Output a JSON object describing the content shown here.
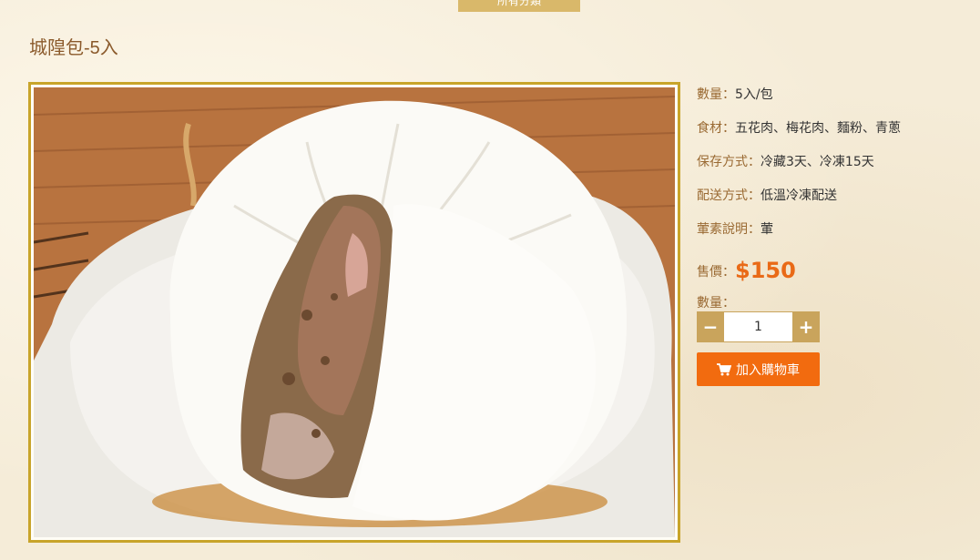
{
  "top_tab": {
    "label": "所有分類"
  },
  "product": {
    "title": "城隍包-5入",
    "image_alt": "城隍包"
  },
  "details": [
    {
      "label": "數量：",
      "value": "5入/包"
    },
    {
      "label": "食材：",
      "value": "五花肉、梅花肉、麵粉、青蔥"
    },
    {
      "label": "保存方式：",
      "value": "冷藏3天、冷凍15天"
    },
    {
      "label": "配送方式：",
      "value": "低溫冷凍配送"
    },
    {
      "label": "葷素說明：",
      "value": "葷"
    }
  ],
  "price": {
    "label": "售價：",
    "value": "$150"
  },
  "quantity": {
    "label": "數量：",
    "value": "1",
    "minus": "−",
    "plus": "+"
  },
  "cart": {
    "label": "加入購物車"
  },
  "colors": {
    "accent_gold": "#c8a42a",
    "button_tan": "#c9a45c",
    "cart_orange": "#f26b0f",
    "price_orange": "#e96a17",
    "label_brown": "#9a6a33"
  },
  "icons": {
    "cart": "shopping-cart-icon"
  }
}
